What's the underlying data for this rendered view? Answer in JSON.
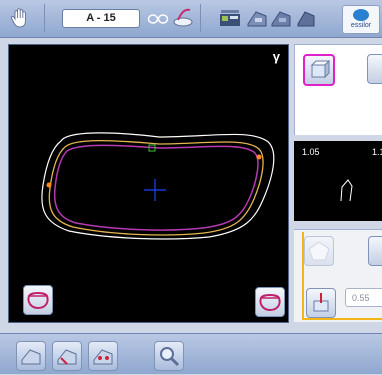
{
  "toolbar": {
    "job_label": "A - 15",
    "brand_label": "essilor"
  },
  "viewer": {
    "mirror_label": "γ"
  },
  "measurements": {
    "left_value": "1.05",
    "right_value": "1.1"
  },
  "input": {
    "value": "0.55"
  },
  "colors": {
    "inner_frame": "#b63ab1",
    "outer_frame": "#ffffff",
    "lens_outline": "#e5b64f",
    "center_cross": "#1a45ff",
    "selected_border": "#e020c8",
    "orange_frame": "#f2b417"
  }
}
